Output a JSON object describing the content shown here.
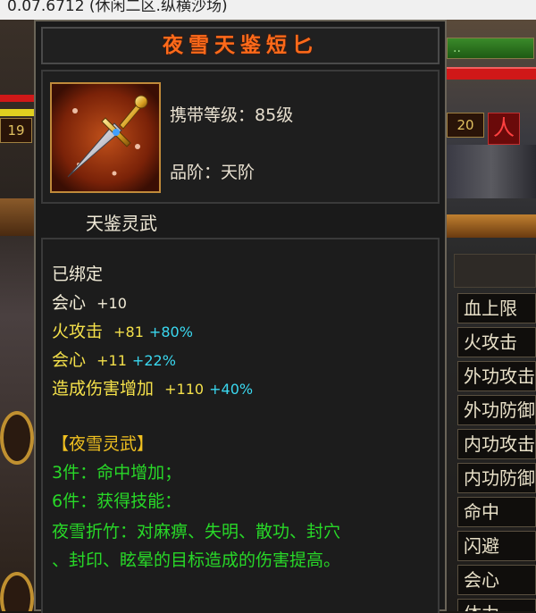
{
  "window": {
    "title": "0.07.6712 (休闲二区.纵横沙场)"
  },
  "background": {
    "left_level": "19",
    "right_level": "20",
    "right_badge": "人",
    "stat_buttons": [
      "血上限",
      "火攻击",
      "外功攻击",
      "外功防御",
      "内功攻击",
      "内功防御",
      "命中",
      "闪避",
      "会心",
      "体力"
    ]
  },
  "tooltip": {
    "item_name": "夜雪天鉴短匕",
    "icon": "dagger-icon",
    "carry_level_label": "携带等级：",
    "carry_level_value": "85级",
    "grade_label": "品阶：",
    "grade_value": "天阶",
    "subtitle": "天鉴灵武",
    "bound": "已绑定",
    "stats": [
      {
        "name": "会心",
        "value": "+10",
        "bonus": ""
      },
      {
        "name": "火攻击",
        "value": "+81",
        "bonus": "+80%"
      },
      {
        "name": "会心",
        "value": "+11",
        "bonus": "+22%"
      },
      {
        "name": "造成伤害增加",
        "value": "+110",
        "bonus": "+40%"
      }
    ],
    "set": {
      "name": "【夜雪灵武】",
      "piece3": "3件：命中增加；",
      "piece6": "6件：获得技能：",
      "skill_line1": "夜雪折竹：对麻痹、失明、散功、封穴",
      "skill_line2": "、封印、眩晕的目标造成的伤害提高。"
    }
  },
  "colors": {
    "title": "#ff6a1a",
    "stat_yellow": "#f4e04a",
    "bonus_cyan": "#3ad8f0",
    "set_green": "#28d828",
    "set_gold": "#f0c020"
  }
}
